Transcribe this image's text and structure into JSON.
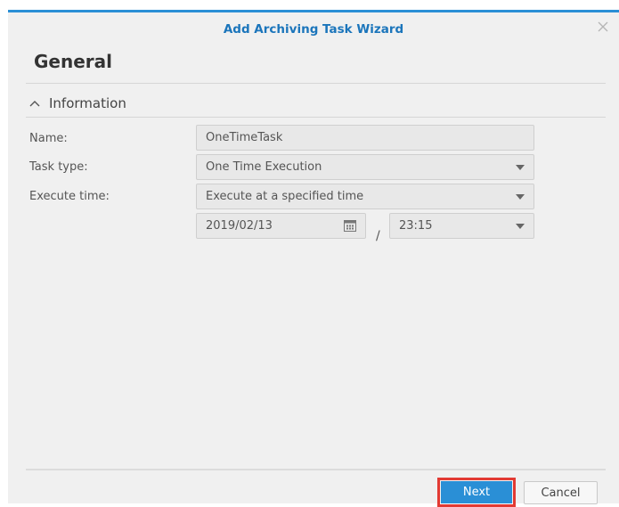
{
  "dialog": {
    "title": "Add Archiving Task Wizard",
    "close_icon": "close-icon"
  },
  "page": {
    "heading": "General"
  },
  "section": {
    "label": "Information",
    "toggle_icon": "chevron-up-icon"
  },
  "form": {
    "name_label": "Name:",
    "name_value": "OneTimeTask",
    "task_type_label": "Task type:",
    "task_type_value": "One Time Execution",
    "execute_time_label": "Execute time:",
    "execute_time_value": "Execute at a specified time",
    "date_value": "2019/02/13",
    "date_icon": "calendar-icon",
    "separator": "/",
    "time_value": "23:15"
  },
  "footer": {
    "next_label": "Next",
    "cancel_label": "Cancel"
  },
  "colors": {
    "accent": "#2a8fd6",
    "title_text": "#1b75bb",
    "highlight": "#e23a33"
  }
}
